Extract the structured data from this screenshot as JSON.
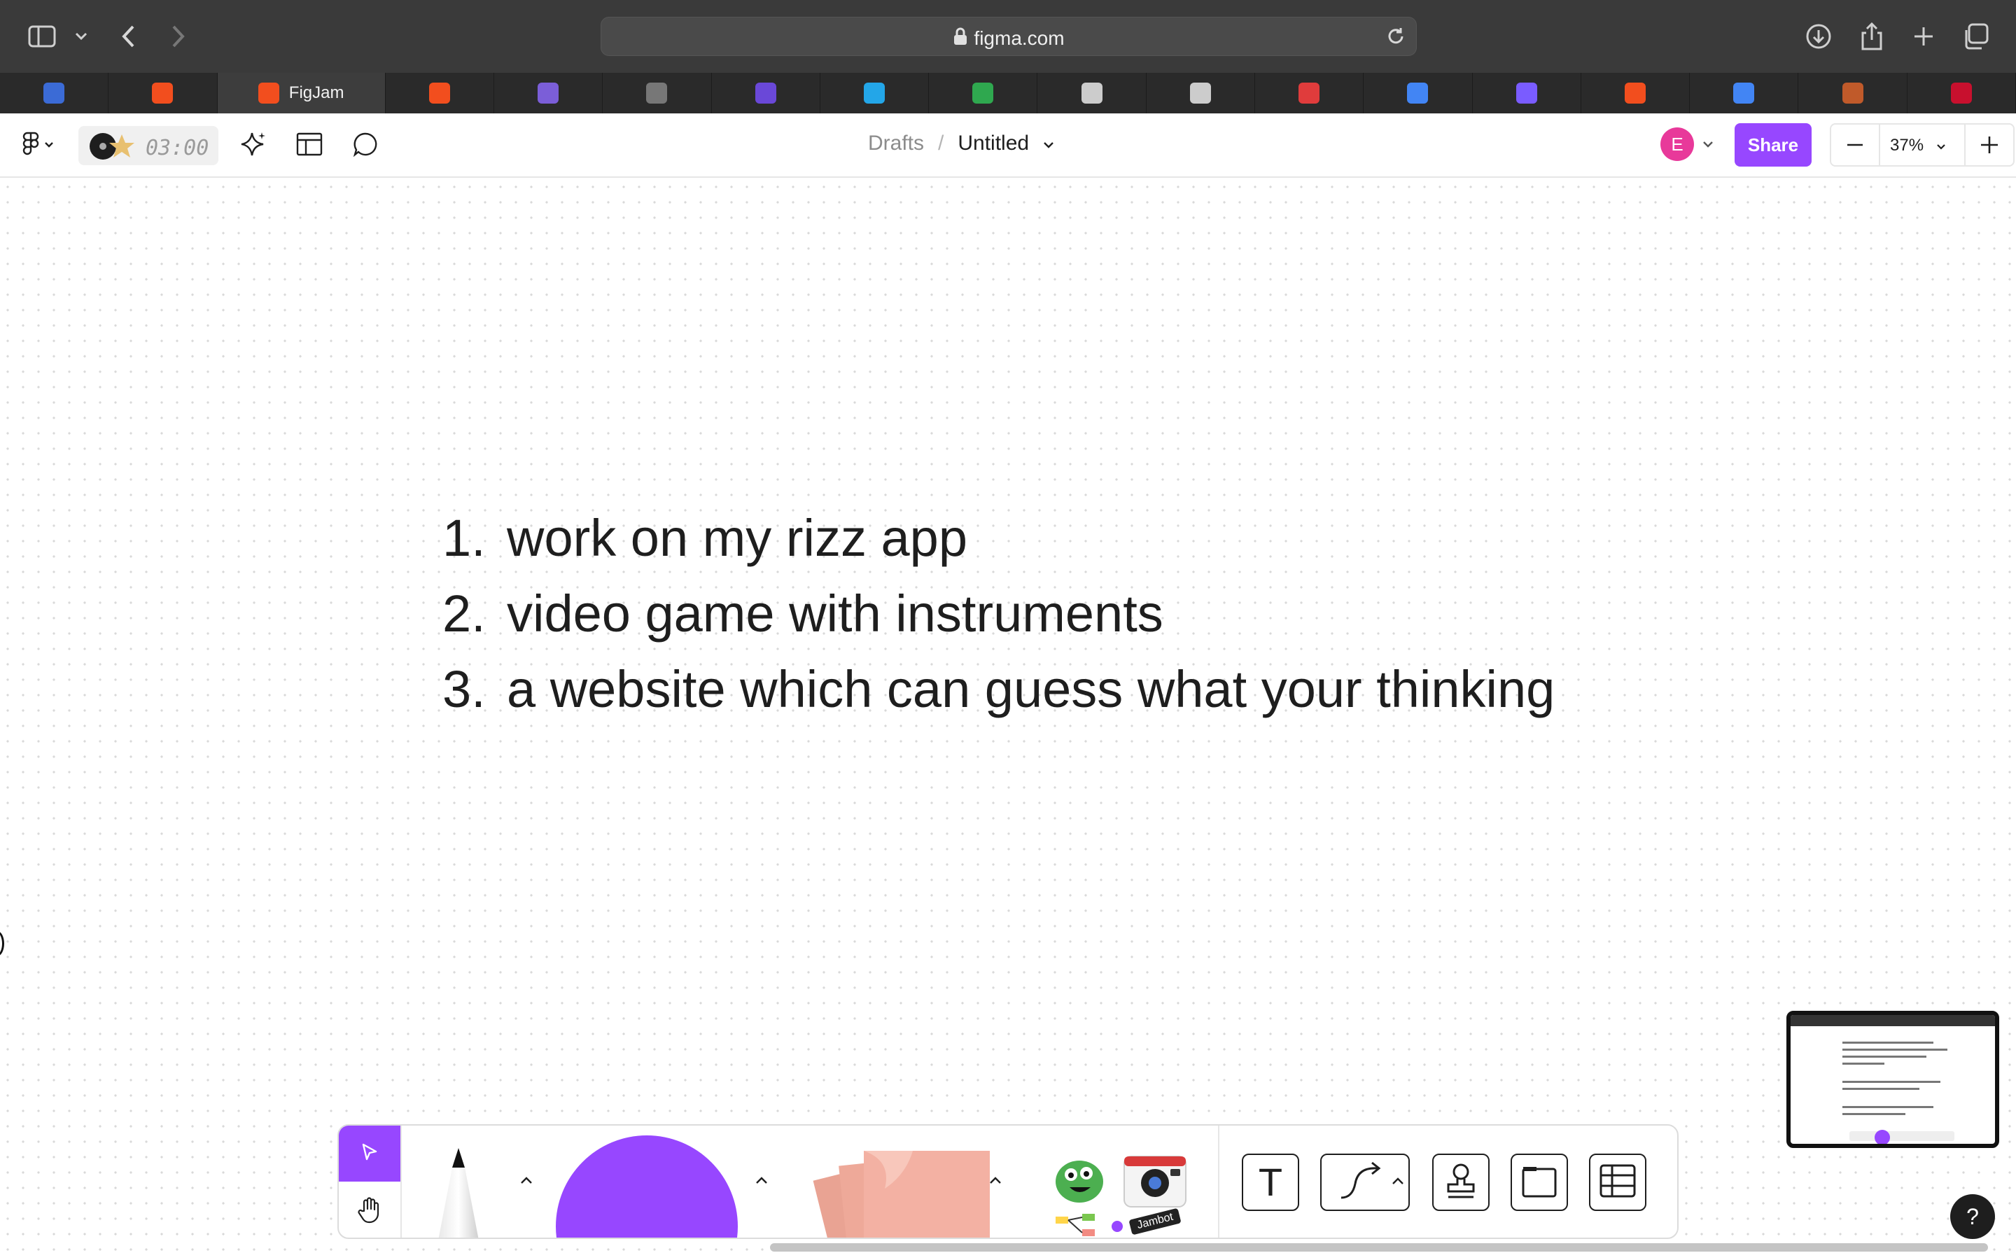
{
  "browser": {
    "url": "figma.com",
    "active_tab_label": "FigJam",
    "tabs": [
      {
        "icon": "s-badge-icon",
        "color": "#3b6bd6"
      },
      {
        "icon": "figma-icon",
        "color": "#f24e1e"
      },
      {
        "icon": "figma-icon",
        "color": "#f24e1e",
        "label": "FigJam",
        "active": true
      },
      {
        "icon": "figma-icon",
        "color": "#f24e1e"
      },
      {
        "icon": "docs-icon",
        "color": "#7b5ed8"
      },
      {
        "icon": "g-icon",
        "color": "#777777"
      },
      {
        "icon": "list-icon",
        "color": "#6a48d8"
      },
      {
        "icon": "square-icon",
        "color": "#23a6e8"
      },
      {
        "icon": "grid-icon",
        "color": "#2fa84f"
      },
      {
        "icon": "pen-icon",
        "color": "#cccccc"
      },
      {
        "icon": "hat-icon",
        "color": "#cccccc"
      },
      {
        "icon": "clapper-icon",
        "color": "#e03c3c"
      },
      {
        "icon": "google-icon",
        "color": "#4285f4"
      },
      {
        "icon": "bookmark-icon",
        "color": "#7a5cff"
      },
      {
        "icon": "figma-icon",
        "color": "#f24e1e"
      },
      {
        "icon": "google-icon",
        "color": "#4285f4"
      },
      {
        "icon": "game-icon",
        "color": "#c05a2a"
      },
      {
        "icon": "knife-icon",
        "color": "#c8102e"
      }
    ]
  },
  "header": {
    "timer": "03:00",
    "breadcrumb_drafts": "Drafts",
    "breadcrumb_sep": "/",
    "file_title": "Untitled",
    "avatar_initial": "E",
    "share_label": "Share",
    "zoom_level": "37%",
    "zoom_out": "−",
    "zoom_in": "+"
  },
  "canvas": {
    "list": [
      {
        "num": "1.",
        "text": "work on my rizz app"
      },
      {
        "num": "2.",
        "text": "video game with instruments"
      },
      {
        "num": "3.",
        "text": "a website which can guess what your thinking"
      }
    ]
  },
  "toolbar": {
    "stickers_badge": "Jambot",
    "text_tool": "T"
  },
  "help": "?",
  "colors": {
    "accent": "#9747ff",
    "avatar": "#e8399a",
    "shape": "#9747ff",
    "sticky": "#f3b1a3"
  }
}
